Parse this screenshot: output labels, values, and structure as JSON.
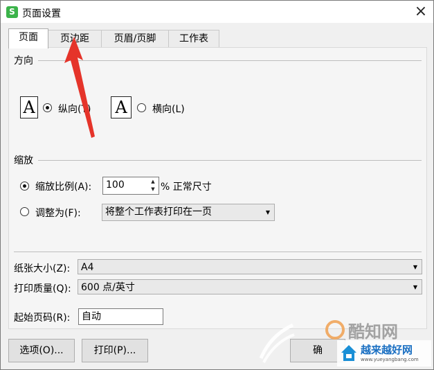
{
  "window": {
    "title": "页面设置",
    "app_icon_letter": "S",
    "close_glyph": "×"
  },
  "tabs": [
    {
      "label": "页面",
      "active": true
    },
    {
      "label": "页边距",
      "active": false
    },
    {
      "label": "页眉/页脚",
      "active": false
    },
    {
      "label": "工作表",
      "active": false
    }
  ],
  "orientation": {
    "section_label": "方向",
    "icon_glyph": "A",
    "portrait_label": "纵向(T)",
    "portrait_selected": true,
    "landscape_label": "横向(L)",
    "landscape_selected": false
  },
  "scaling": {
    "section_label": "缩放",
    "scale_label": "缩放比例(A):",
    "scale_selected": true,
    "scale_value": "100",
    "scale_suffix": "% 正常尺寸",
    "fit_label": "调整为(F):",
    "fit_selected": false,
    "fit_value": "将整个工作表打印在一页"
  },
  "paper": {
    "paper_size_label": "纸张大小(Z):",
    "paper_size_value": "A4",
    "print_quality_label": "打印质量(Q):",
    "print_quality_value": "600 点/英寸",
    "first_page_label": "起始页码(R):",
    "first_page_value": "自动"
  },
  "buttons": {
    "options": "选项(O)...",
    "print": "打印(P)...",
    "ok_partial": "确"
  },
  "watermark": {
    "text1": "酷知网",
    "text2": "越来越好网",
    "text3": "www.yueyangbang.com"
  },
  "colors": {
    "annotation_arrow": "#e5342a",
    "app_icon": "#3bb34a"
  }
}
